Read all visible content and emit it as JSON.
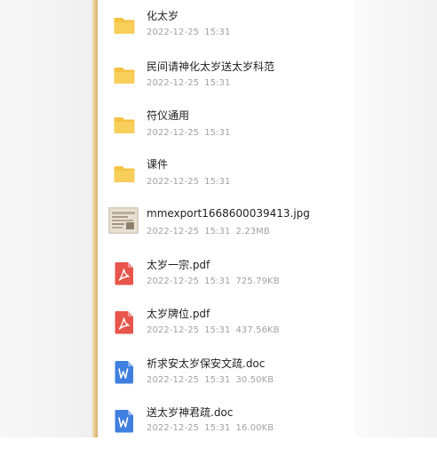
{
  "files": [
    {
      "name": "化太岁",
      "date": "2022-12-25",
      "time": "15:31",
      "size": "",
      "type": "folder",
      "icon": "folder-icon"
    },
    {
      "name": "民间请神化太岁送太岁科范",
      "date": "2022-12-25",
      "time": "15:31",
      "size": "",
      "type": "folder",
      "icon": "folder-icon"
    },
    {
      "name": "符仪通用",
      "date": "2022-12-25",
      "time": "15:31",
      "size": "",
      "type": "folder",
      "icon": "folder-icon"
    },
    {
      "name": "课件",
      "date": "2022-12-25",
      "time": "15:31",
      "size": "",
      "type": "folder",
      "icon": "folder-icon"
    },
    {
      "name": "mmexport1668600039413.jpg",
      "date": "2022-12-25",
      "time": "15:31",
      "size": "2.23MB",
      "type": "image",
      "icon": "image-thumbnail-icon"
    },
    {
      "name": "太岁一宗.pdf",
      "date": "2022-12-25",
      "time": "15:31",
      "size": "725.79KB",
      "type": "pdf",
      "icon": "pdf-icon"
    },
    {
      "name": "太岁牌位.pdf",
      "date": "2022-12-25",
      "time": "15:31",
      "size": "437.56KB",
      "type": "pdf",
      "icon": "pdf-icon"
    },
    {
      "name": "祈求安太岁保安文疏.doc",
      "date": "2022-12-25",
      "time": "15:31",
      "size": "30.50KB",
      "type": "doc",
      "icon": "word-doc-icon"
    },
    {
      "name": "送太岁神君疏.doc",
      "date": "2022-12-25",
      "time": "15:31",
      "size": "16.00KB",
      "type": "doc",
      "icon": "word-doc-icon"
    }
  ],
  "colors": {
    "folder": "#f5c242",
    "pdf": "#e8554b",
    "doc": "#3f7fe0",
    "edge": "#e7c98f"
  }
}
